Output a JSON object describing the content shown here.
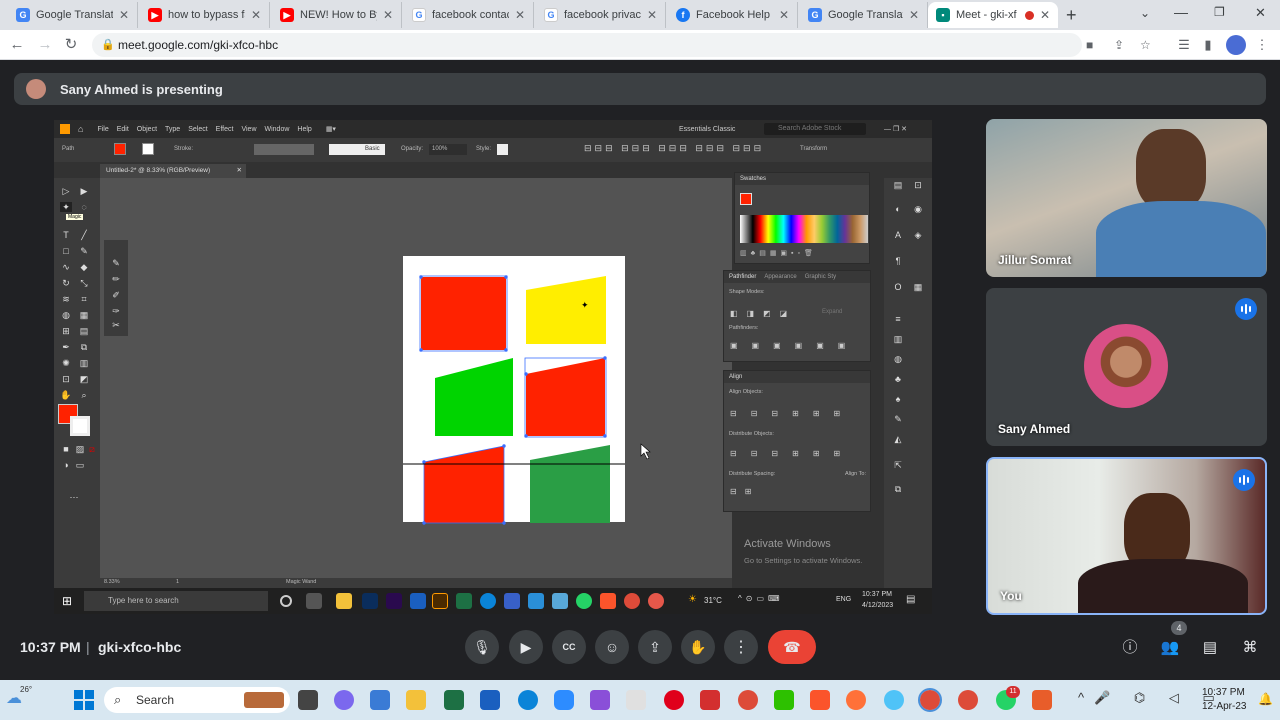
{
  "browser": {
    "tabs": [
      {
        "label": "Google Translate",
        "favicon": "google-translate-icon",
        "color": "#4285f4"
      },
      {
        "label": "how to bypass fac",
        "favicon": "youtube-icon",
        "color": "#ff0000"
      },
      {
        "label": "NEW! How to Byp",
        "favicon": "youtube-icon",
        "color": "#ff0000"
      },
      {
        "label": "facebook contact",
        "favicon": "google-icon",
        "color": "#4285f4"
      },
      {
        "label": "facebook privacy",
        "favicon": "google-icon",
        "color": "#4285f4"
      },
      {
        "label": "Facebook Help C",
        "favicon": "facebook-icon",
        "color": "#1877f2"
      },
      {
        "label": "Google Translate",
        "favicon": "google-translate-icon",
        "color": "#4285f4"
      },
      {
        "label": "Meet - gki-xf",
        "favicon": "meet-icon",
        "color": "#00897b"
      }
    ],
    "new_tab": "+",
    "url": "meet.google.com/gki-xfco-hbc"
  },
  "presenting": {
    "text": "Sany Ahmed is presenting"
  },
  "illustrator": {
    "menu": [
      "File",
      "Edit",
      "Object",
      "Type",
      "Select",
      "Effect",
      "View",
      "Window",
      "Help"
    ],
    "workspace": "Essentials Classic",
    "search_placeholder": "Search Adobe Stock",
    "options": {
      "path": "Path",
      "stroke": "Stroke:",
      "basic": "Basic",
      "opacity_label": "Opacity:",
      "opacity": "100%",
      "style": "Style:",
      "transform": "Transform"
    },
    "doc_tab": "Untitled-2* @ 8.33% (RGB/Preview)",
    "tooltip": "Magic",
    "panels": {
      "swatches": "Swatches",
      "pathfinder": "Pathfinder",
      "appearance": "Appearance",
      "graphic_styles": "Graphic Sty",
      "shape_modes": "Shape Modes:",
      "expand": "Expand",
      "pathfinders": "Pathfinders:",
      "align": "Align",
      "align_objects": "Align Objects:",
      "distribute_objects": "Distribute Objects:",
      "distribute_spacing": "Distribute Spacing:",
      "align_to": "Align To:"
    },
    "status": {
      "zoom": "8.33%",
      "page": "1",
      "tool": "Magic Wand"
    },
    "activate_title": "Activate Windows",
    "activate_sub": "Go to Settings to activate Windows.",
    "shapes": [
      {
        "name": "red-rectangle-top-left",
        "color": "#ff2200"
      },
      {
        "name": "yellow-quad-top-right",
        "color": "#ffee00"
      },
      {
        "name": "green-quad-middle-left",
        "color": "#00d400"
      },
      {
        "name": "red-quad-middle-right",
        "color": "#ff2200"
      },
      {
        "name": "red-quad-bottom-left",
        "color": "#ff2200"
      },
      {
        "name": "green-quad-bottom-right",
        "color": "#2a9e45"
      }
    ],
    "remote_taskbar": {
      "search": "Type here to search",
      "weather": "31°C",
      "lang": "ENG",
      "time": "10:37 PM",
      "date": "4/12/2023"
    }
  },
  "participants": [
    {
      "name": "Jillur Somrat",
      "speaking": false
    },
    {
      "name": "Sany Ahmed",
      "speaking": true
    },
    {
      "name": "You",
      "speaking": true
    }
  ],
  "meeting": {
    "time": "10:37 PM",
    "separator": "|",
    "code": "gki-xfco-hbc",
    "people_count": "4"
  },
  "windows": {
    "weather": "26°",
    "search": "Search",
    "time": "10:37 PM",
    "date": "12-Apr-23",
    "notification_badge": "11"
  }
}
